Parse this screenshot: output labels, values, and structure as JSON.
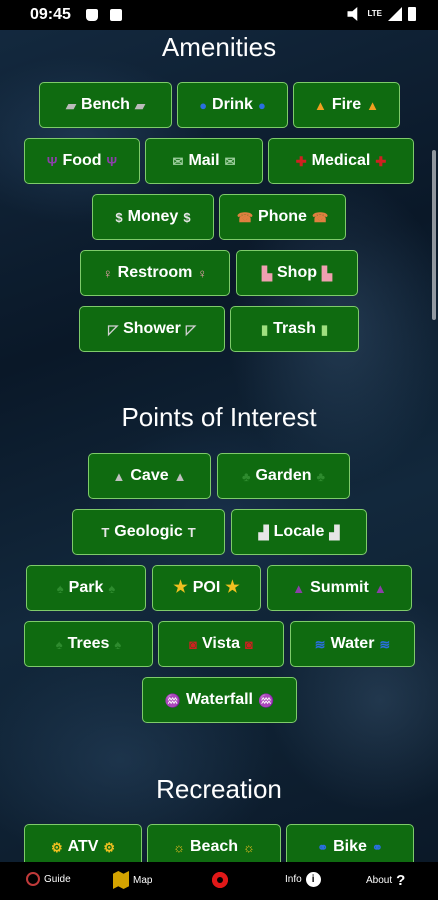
{
  "status_bar": {
    "time": "09:45",
    "network": "LTE"
  },
  "sections": {
    "amenities": {
      "title": "Amenities"
    },
    "poi": {
      "title": "Points of Interest"
    },
    "recreation": {
      "title": "Recreation"
    }
  },
  "amenities": [
    {
      "label": "Bench",
      "icon": "bench-icon",
      "color": "#bbbbbb"
    },
    {
      "label": "Drink",
      "icon": "water-drop-icon",
      "color": "#2a6fe0"
    },
    {
      "label": "Fire",
      "icon": "fire-icon",
      "color": "#f0a020"
    },
    {
      "label": "Food",
      "icon": "utensils-icon",
      "color": "#8a3fa8"
    },
    {
      "label": "Mail",
      "icon": "envelope-icon",
      "color": "#9fd09f"
    },
    {
      "label": "Medical",
      "icon": "first-aid-icon",
      "color": "#d02020"
    },
    {
      "label": "Money",
      "icon": "dollar-icon",
      "color": "#e6e6e6"
    },
    {
      "label": "Phone",
      "icon": "phone-icon",
      "color": "#e08040"
    },
    {
      "label": "Restroom",
      "icon": "person-icon",
      "color": "#f0a0b0"
    },
    {
      "label": "Shop",
      "icon": "cart-icon",
      "color": "#f0a0b0"
    },
    {
      "label": "Shower",
      "icon": "shower-icon",
      "color": "#d0d0d0"
    },
    {
      "label": "Trash",
      "icon": "trash-icon",
      "color": "#9fe07f"
    }
  ],
  "poi": [
    {
      "label": "Cave",
      "icon": "mountain-icon",
      "color": "#c0c0c0"
    },
    {
      "label": "Garden",
      "icon": "plant-icon",
      "color": "#2e8b2e"
    },
    {
      "label": "Geologic",
      "icon": "hammer-icon",
      "color": "#e6e6e6"
    },
    {
      "label": "Locale",
      "icon": "city-icon",
      "color": "#e6e6e6"
    },
    {
      "label": "Park",
      "icon": "tree-icon",
      "color": "#2e8b2e"
    },
    {
      "label": "POI",
      "icon": "star-icon",
      "color": "#f0c020"
    },
    {
      "label": "Summit",
      "icon": "peak-icon",
      "color": "#8a3fa8"
    },
    {
      "label": "Trees",
      "icon": "tree-icon",
      "color": "#2e8b2e"
    },
    {
      "label": "Vista",
      "icon": "camera-icon",
      "color": "#d02020"
    },
    {
      "label": "Water",
      "icon": "waves-icon",
      "color": "#2a6fe0"
    },
    {
      "label": "Waterfall",
      "icon": "waterfall-icon",
      "color": "#2a6fe0"
    }
  ],
  "recreation": [
    {
      "label": "ATV",
      "icon": "atv-icon",
      "color": "#f0c020"
    },
    {
      "label": "Beach",
      "icon": "sun-icon",
      "color": "#f0c020"
    },
    {
      "label": "Bike",
      "icon": "bicycle-icon",
      "color": "#2a6fe0"
    }
  ],
  "nav": {
    "guide": "Guide",
    "map": "Map",
    "info": "Info",
    "about": "About"
  }
}
